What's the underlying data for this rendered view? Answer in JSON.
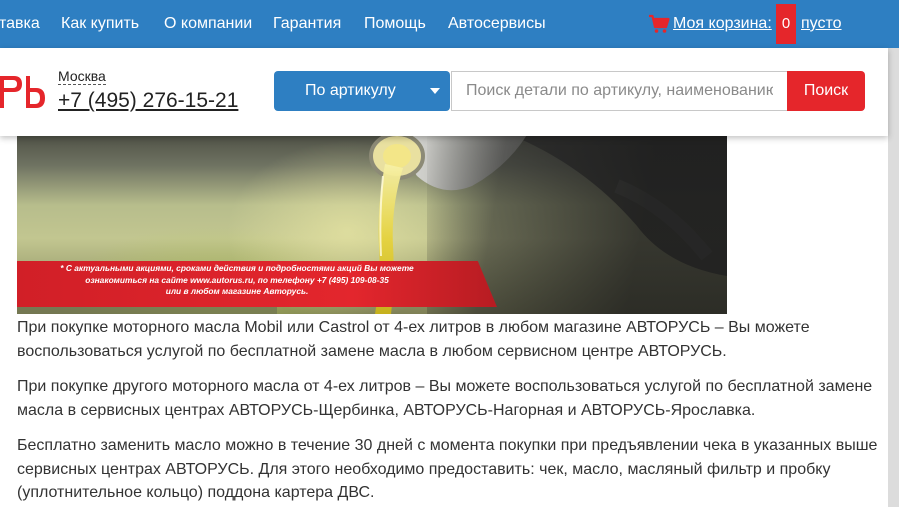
{
  "topnav": {
    "items": [
      "тавка",
      "Как купить",
      "О компании",
      "Гарантия",
      "Помощь",
      "Автосервисы"
    ],
    "cart_label": "Моя корзина:",
    "cart_count": "0",
    "cart_status": "пусто"
  },
  "header": {
    "city": "Москва",
    "phone": "+7 (495) 276-15-21",
    "search_type": "По артикулу",
    "search_placeholder": "Поиск детали по артикулу, наименованию",
    "search_button": "Поиск"
  },
  "banner": {
    "disclaimer_lines": [
      "* С актуальными акциями, сроками действия и подробностями акций Вы можете",
      "ознакомиться на сайте www.autorus.ru, по телефону +7 (495) 109-08-35",
      "или в любом магазине Авторусь."
    ]
  },
  "article": {
    "paragraphs": [
      "При покупке моторного масла Mobil или Castrol от 4-ех литров в любом магазине АВТОРУСЬ – Вы можете воспользоваться услугой по бесплатной замене масла в любом сервисном центре АВТОРУСЬ.",
      "При покупке другого моторного масла от 4-ех литров – Вы можете воспользоваться услугой по бесплатной замене масла в сервисных центрах  АВТОРУСЬ-Щербинка, АВТОРУСЬ-Нагорная  и АВТОРУСЬ-Ярославка.",
      "Бесплатно заменить масло можно в течение 30 дней с момента покупки при предъявлении чека в указанных выше сервисных центрах АВТОРУСЬ. Для этого необходимо предоставить: чек, масло, масляный фильтр и пробку (уплотнительное кольцо) поддона картера ДВС."
    ]
  },
  "colors": {
    "nav_blue": "#2e7fc2",
    "accent_red": "#e5262b"
  }
}
